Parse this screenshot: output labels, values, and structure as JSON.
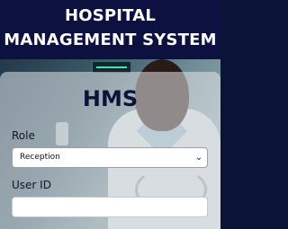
{
  "header": {
    "line1": "HOSPITAL",
    "line2": "MANAGEMENT SYSTEM"
  },
  "form": {
    "title": "HMS",
    "role_label": "Role",
    "role_selected": "Reception",
    "userid_label": "User ID",
    "userid_value": ""
  },
  "icons": {
    "dropdown": "chevron-down-icon"
  }
}
